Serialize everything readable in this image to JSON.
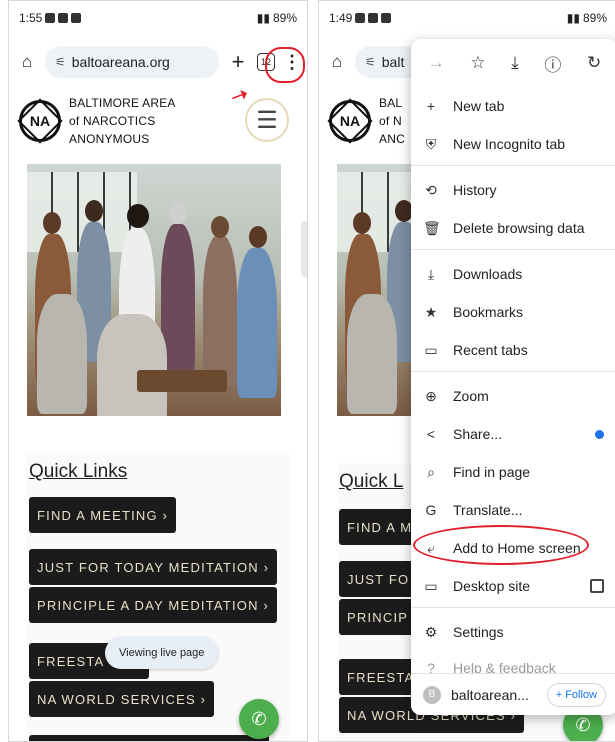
{
  "left_phone": {
    "status": {
      "time": "1:55",
      "battery": "89%"
    },
    "url": "baltoareana.org",
    "tab_count": "12",
    "site_header": {
      "line1": "BALTIMORE AREA",
      "line2": "of NARCOTICS",
      "line3": "ANONYMOUS",
      "logo": "NA"
    },
    "quick_links_title": "Quick Links",
    "links": [
      "FIND A MEETING ›",
      "JUST FOR TODAY MEDITATION ›",
      "PRINCIPLE A DAY MEDITATION ›",
      "FREESTA",
      "NA WORLD SERVICES ›"
    ],
    "toast": "Viewing live page"
  },
  "right_phone": {
    "status": {
      "time": "1:49",
      "battery": "89%"
    },
    "url_fragment": "balt",
    "site_header": {
      "line1": "BAL",
      "line2": "of N",
      "line3": "ANC"
    },
    "quick_links_fragment": "Quick L",
    "links": [
      "FIND A M",
      "JUST FO",
      "PRINCIP",
      "FREESTA",
      "NA WORLD SERVICES ›"
    ],
    "menu": {
      "toolbar_icons": [
        "forward-icon",
        "star-icon",
        "download-icon",
        "info-icon",
        "refresh-icon"
      ],
      "items": [
        {
          "label": "New tab",
          "icon": "+"
        },
        {
          "label": "New Incognito tab",
          "icon": "⛨"
        },
        {
          "label": "History",
          "icon": "⟲"
        },
        {
          "label": "Delete browsing data",
          "icon": "🗑"
        },
        {
          "label": "Downloads",
          "icon": "⤓"
        },
        {
          "label": "Bookmarks",
          "icon": "★"
        },
        {
          "label": "Recent tabs",
          "icon": "▭"
        },
        {
          "label": "Zoom",
          "icon": "⊕"
        },
        {
          "label": "Share...",
          "icon": "<"
        },
        {
          "label": "Find in page",
          "icon": "⌕"
        },
        {
          "label": "Translate...",
          "icon": "G"
        },
        {
          "label": "Add to Home screen",
          "icon": "⤶"
        },
        {
          "label": "Desktop site",
          "icon": "▭"
        },
        {
          "label": "Settings",
          "icon": "⚙"
        },
        {
          "label": "Help & feedback",
          "icon": "?"
        }
      ],
      "bottom": {
        "site": "baltoarean...",
        "badge": "B",
        "follow": "+ Follow"
      }
    }
  },
  "annotation_color": "#e0202b",
  "accent_blue": "#1a73e8",
  "fab_color": "#4cae4c"
}
